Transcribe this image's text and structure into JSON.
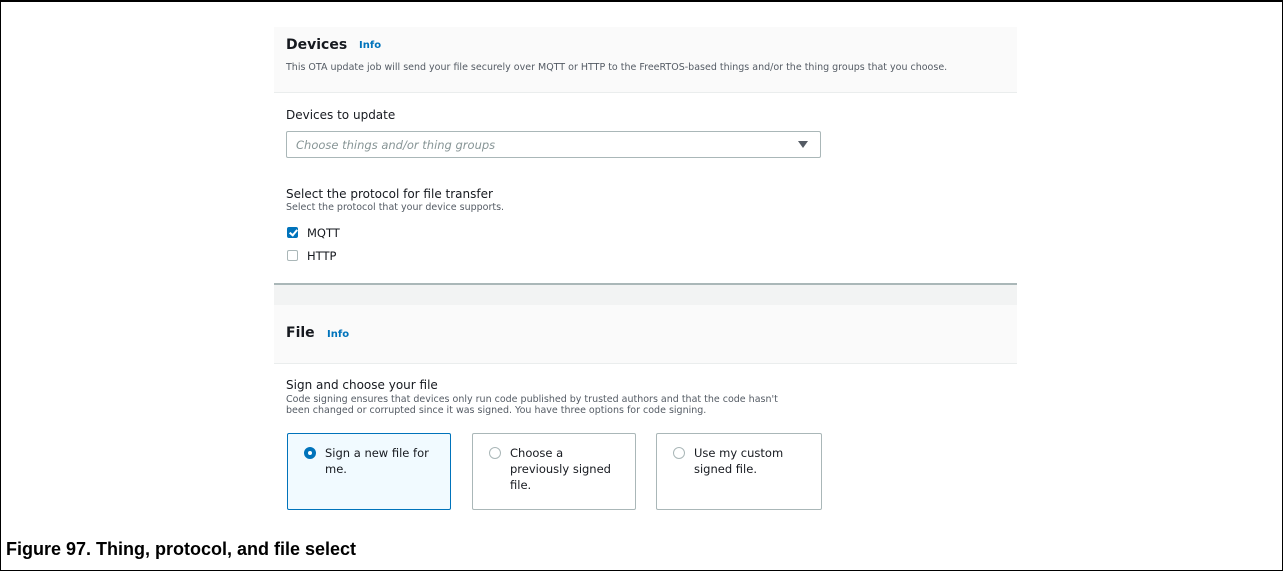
{
  "devices": {
    "title": "Devices",
    "info": "Info",
    "description": "This OTA update job will send your file securely over MQTT or HTTP to the FreeRTOS-based things and/or the thing groups that you choose."
  },
  "devices_to_update": {
    "label": "Devices to update",
    "placeholder": "Choose things and/or thing groups"
  },
  "protocol": {
    "label": "Select the protocol for file transfer",
    "description": "Select the protocol that your device supports.",
    "options": [
      {
        "label": "MQTT",
        "checked": true
      },
      {
        "label": "HTTP",
        "checked": false
      }
    ]
  },
  "file": {
    "title": "File",
    "info": "Info"
  },
  "sign": {
    "label": "Sign and choose your file",
    "description_line1": "Code signing ensures that devices only run code published by trusted authors and that the code hasn't",
    "description_line2": "been changed or corrupted since it was signed. You have three options for code signing.",
    "options": [
      {
        "line1": "Sign a new file for",
        "line2": "me.",
        "line3": "",
        "selected": true
      },
      {
        "line1": "Choose a",
        "line2": "previously signed",
        "line3": "file.",
        "selected": false
      },
      {
        "line1": "Use my custom",
        "line2": "signed file.",
        "line3": "",
        "selected": false
      }
    ]
  },
  "caption": "Figure 97.  Thing, protocol, and file select",
  "colors": {
    "accent": "#0073bb",
    "text": "#16191f",
    "muted": "#545b64"
  }
}
